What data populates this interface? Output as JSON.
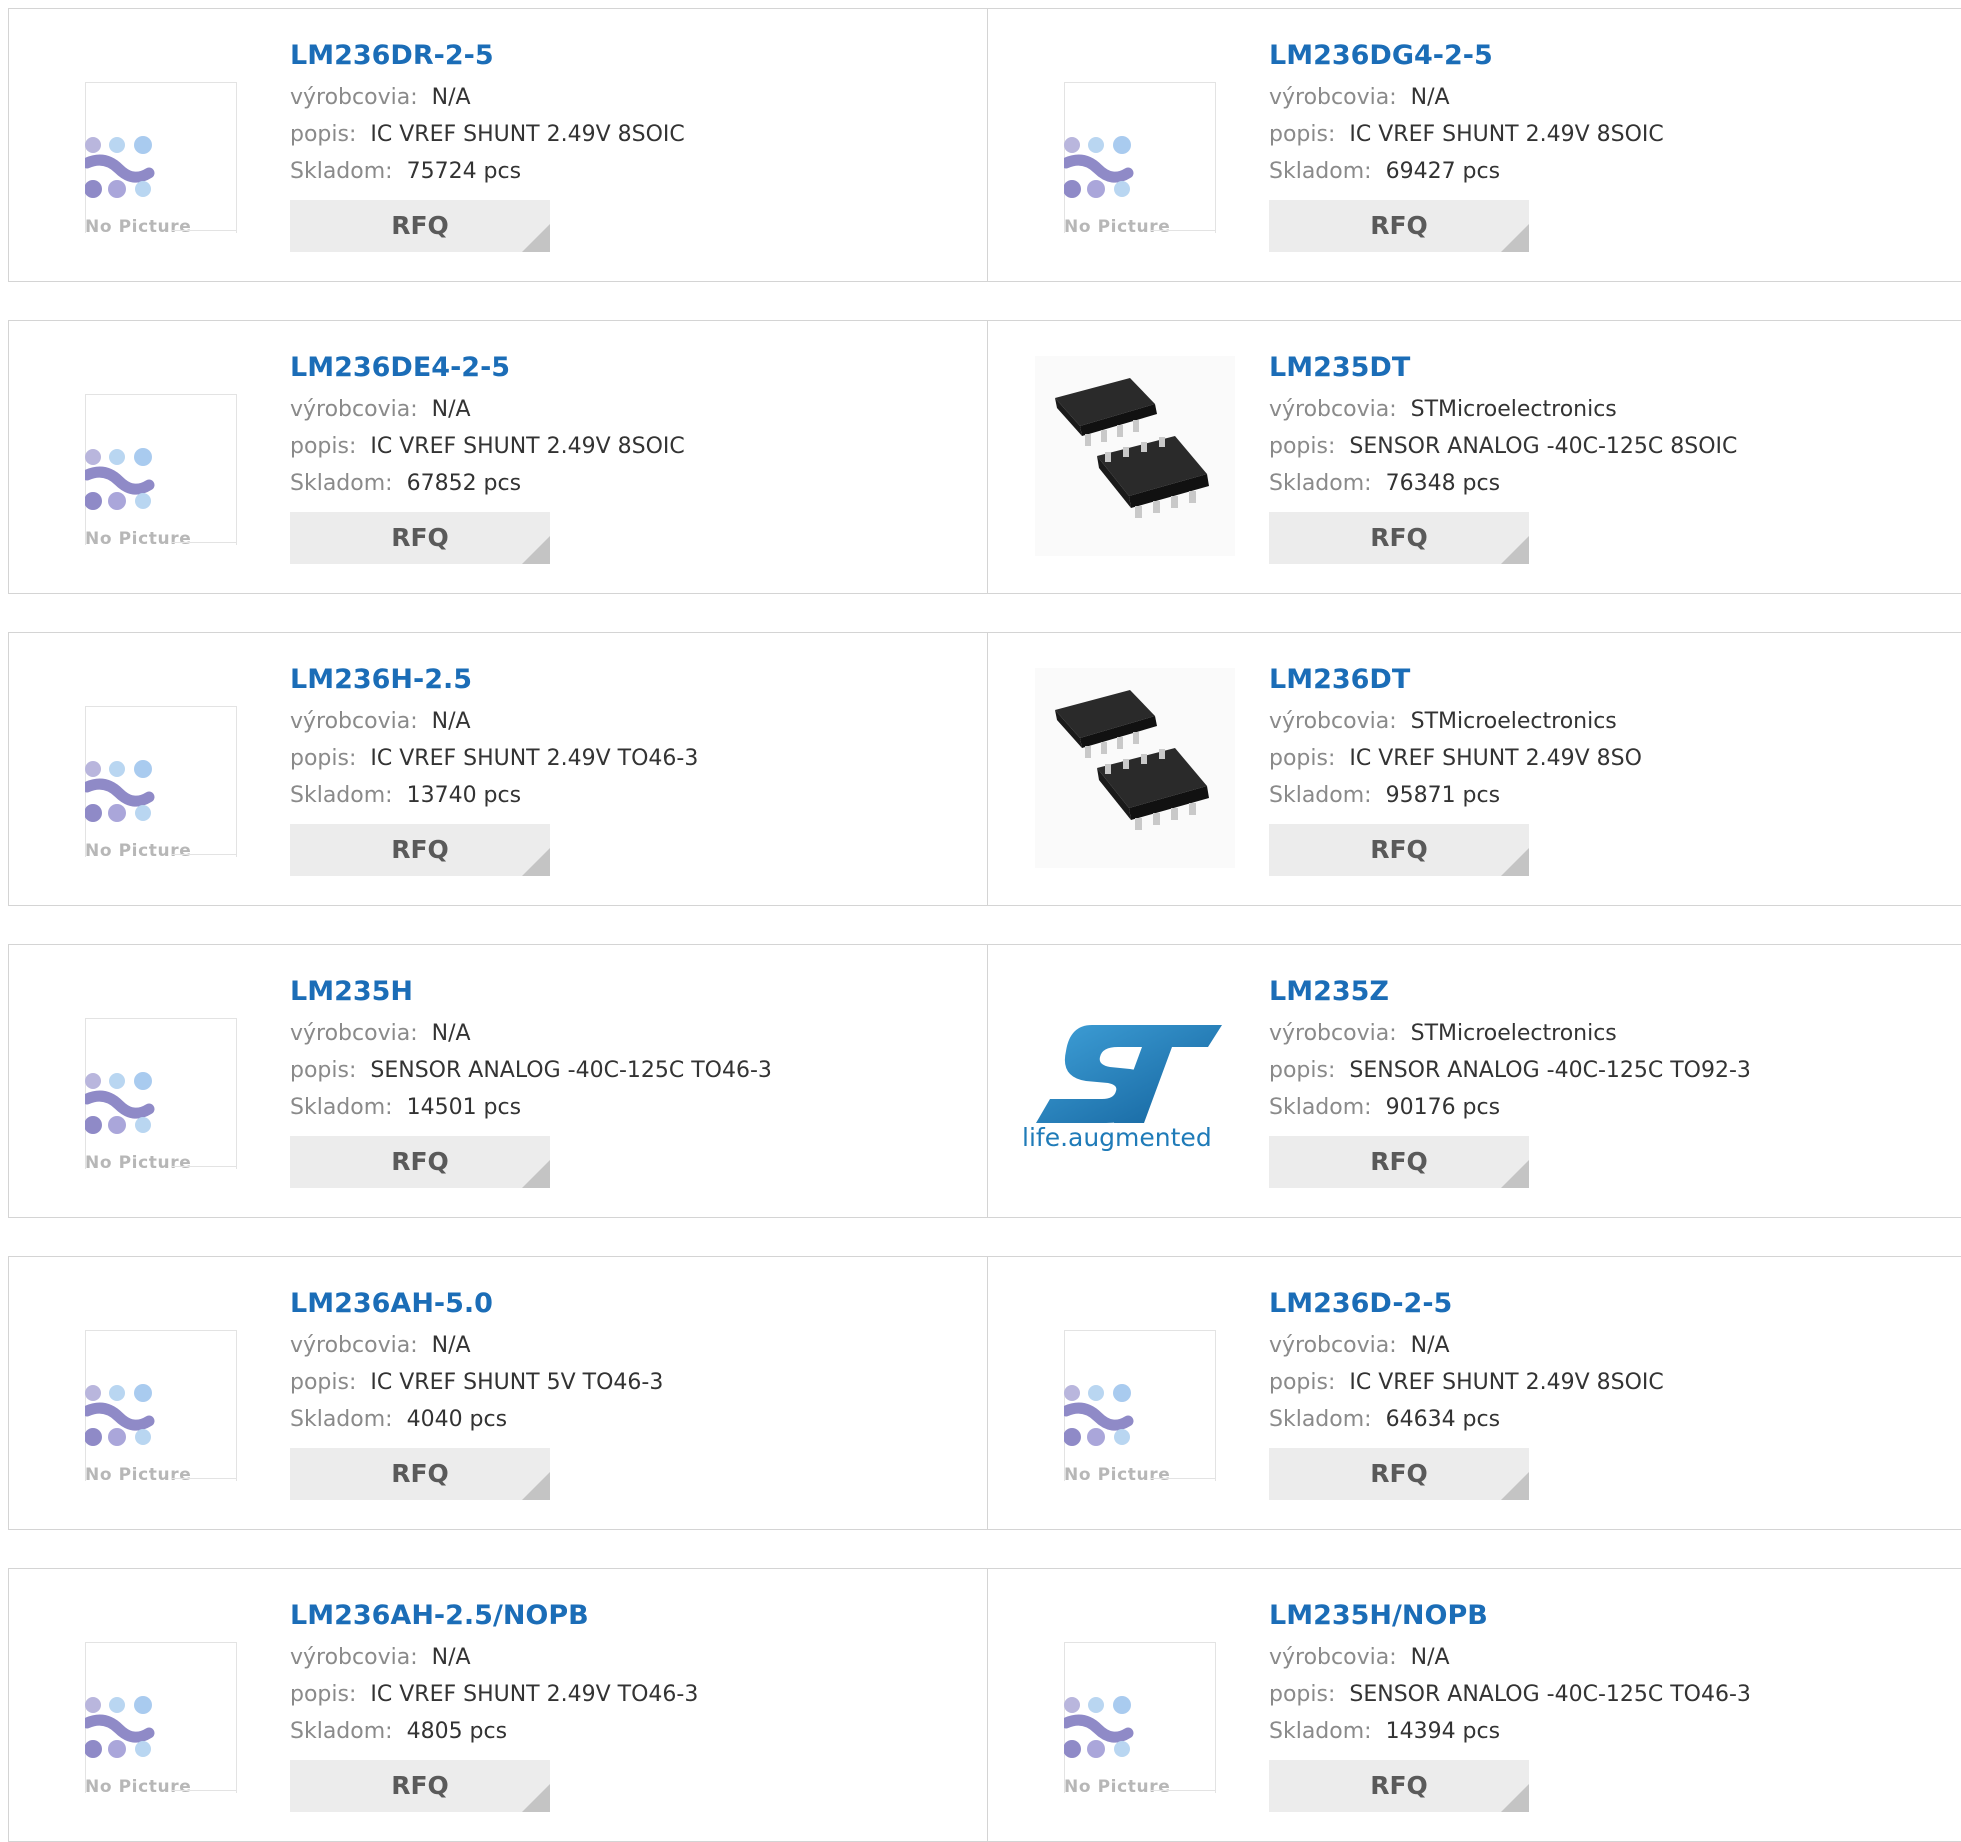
{
  "labels": {
    "manufacturer": "výrobcovia:",
    "description": "popis:",
    "stock": "Skladom:",
    "rfq": "RFQ",
    "no_picture": "No Picture",
    "st_tagline": "life.augmented"
  },
  "products": [
    {
      "part": "LM236DR-2-5",
      "manufacturer": "N/A",
      "description": "IC VREF SHUNT 2.49V 8SOIC",
      "stock": "75724 pcs",
      "image": "no-picture"
    },
    {
      "part": "LM236DG4-2-5",
      "manufacturer": "N/A",
      "description": "IC VREF SHUNT 2.49V 8SOIC",
      "stock": "69427 pcs",
      "image": "no-picture"
    },
    {
      "part": "LM236DE4-2-5",
      "manufacturer": "N/A",
      "description": "IC VREF SHUNT 2.49V 8SOIC",
      "stock": "67852 pcs",
      "image": "no-picture"
    },
    {
      "part": "LM235DT",
      "manufacturer": "STMicroelectronics",
      "description": "SENSOR ANALOG -40C-125C 8SOIC",
      "stock": "76348 pcs",
      "image": "soic-chip"
    },
    {
      "part": "LM236H-2.5",
      "manufacturer": "N/A",
      "description": "IC VREF SHUNT 2.49V TO46-3",
      "stock": "13740 pcs",
      "image": "no-picture"
    },
    {
      "part": "LM236DT",
      "manufacturer": "STMicroelectronics",
      "description": "IC VREF SHUNT 2.49V 8SO",
      "stock": "95871 pcs",
      "image": "soic-chip"
    },
    {
      "part": "LM235H",
      "manufacturer": "N/A",
      "description": "SENSOR ANALOG -40C-125C TO46-3",
      "stock": "14501 pcs",
      "image": "no-picture"
    },
    {
      "part": "LM235Z",
      "manufacturer": "STMicroelectronics",
      "description": "SENSOR ANALOG -40C-125C TO92-3",
      "stock": "90176 pcs",
      "image": "st-logo"
    },
    {
      "part": "LM236AH-5.0",
      "manufacturer": "N/A",
      "description": "IC VREF SHUNT 5V TO46-3",
      "stock": "4040 pcs",
      "image": "no-picture"
    },
    {
      "part": "LM236D-2-5",
      "manufacturer": "N/A",
      "description": "IC VREF SHUNT 2.49V 8SOIC",
      "stock": "64634 pcs",
      "image": "no-picture"
    },
    {
      "part": "LM236AH-2.5/NOPB",
      "manufacturer": "N/A",
      "description": "IC VREF SHUNT 2.49V TO46-3",
      "stock": "4805 pcs",
      "image": "no-picture"
    },
    {
      "part": "LM235H/NOPB",
      "manufacturer": "N/A",
      "description": "SENSOR ANALOG -40C-125C TO46-3",
      "stock": "14394 pcs",
      "image": "no-picture"
    }
  ],
  "colors": {
    "link": "#1b6db7",
    "label": "#8a8a8a",
    "rfq_bg": "#ececec",
    "st_blue": "#1f7bb8"
  }
}
